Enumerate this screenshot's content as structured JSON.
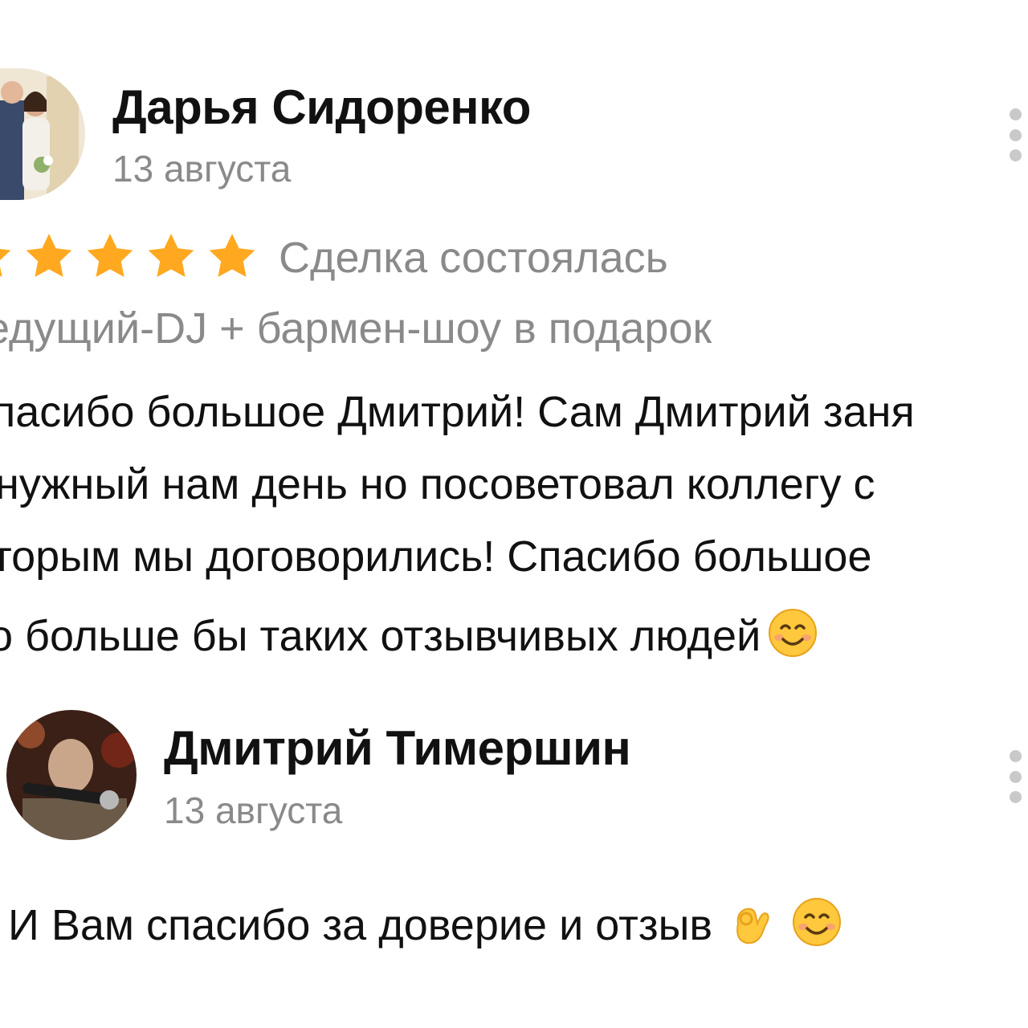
{
  "review": {
    "author_name": "Дарья Сидоренко",
    "date": "13 августа",
    "rating_stars": 5,
    "deal_status": "Сделка состоялась",
    "service": "едущий-DJ + бармен-шоу в подарок",
    "text_lines": [
      "пасибо большое Дмитрий! Сам Дмитрий заня",
      "нужный нам день но посоветовал коллегу с",
      "торым мы договорились! Спасибо большое",
      "о больше бы таких отзывчивых людей"
    ],
    "end_emoji": "smiling-face-emoji"
  },
  "reply": {
    "author_name": "Дмитрий Тимершин",
    "date": "13 августа",
    "text": "И Вам спасибо за доверие и отзыв",
    "emojis": [
      "ok-hand-emoji",
      "smiling-face-emoji"
    ]
  },
  "colors": {
    "star": "#FFA820",
    "muted_text": "#8a8a8a",
    "main_text": "#111111",
    "more_dots": "#c9c9c9"
  },
  "icons": {
    "more": "vertical-dots-icon"
  }
}
